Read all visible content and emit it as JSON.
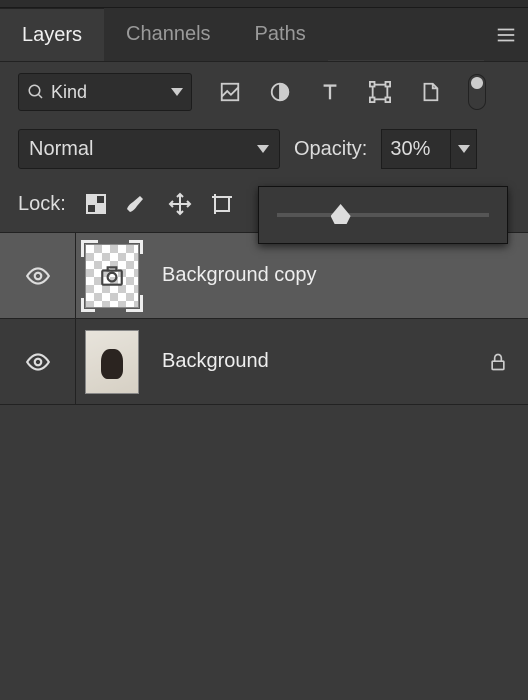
{
  "tabs": {
    "layers": "Layers",
    "channels": "Channels",
    "paths": "Paths"
  },
  "filter": {
    "label": "Kind"
  },
  "blend": {
    "mode": "Normal"
  },
  "opacity": {
    "label": "Opacity:",
    "value": "30%",
    "slider_percent": 30
  },
  "lock": {
    "label": "Lock:"
  },
  "layers": [
    {
      "name": "Background copy",
      "selected": true,
      "locked": false
    },
    {
      "name": "Background",
      "selected": false,
      "locked": true
    }
  ]
}
